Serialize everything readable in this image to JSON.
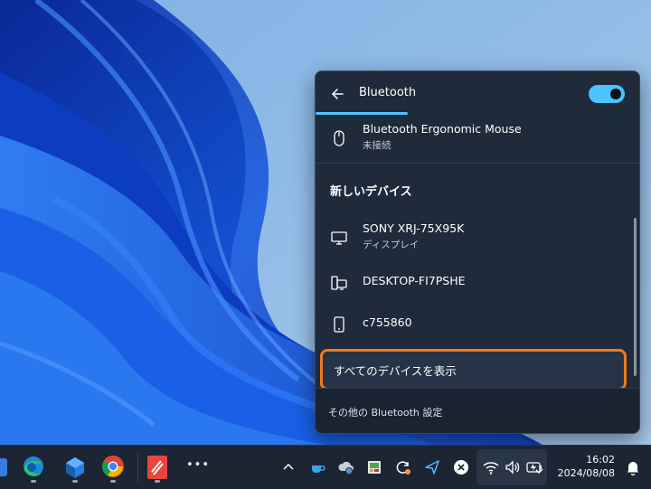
{
  "flyout": {
    "title": "Bluetooth",
    "toggle_on": true,
    "paired_device": {
      "name": "Bluetooth Ergonomic Mouse",
      "status": "未接続",
      "icon": "mouse-icon"
    },
    "new_devices_heading": "新しいデバイス",
    "new_devices": [
      {
        "name": "SONY XRJ-75X95K",
        "status": "ディスプレイ",
        "icon": "monitor-icon"
      },
      {
        "name": "DESKTOP-FI7PSHE",
        "status": "",
        "icon": "desktop-computer-icon"
      },
      {
        "name": "c755860",
        "status": "",
        "icon": "phone-icon"
      }
    ],
    "show_all_label": "すべてのデバイスを表示",
    "footer_link": "その他の Bluetooth 設定"
  },
  "taskbar": {
    "apps": [
      "edge-icon",
      "app-cube-icon",
      "chrome-icon",
      "pdf-app-icon"
    ],
    "more_label": "•••",
    "tray_icons": [
      "chevron-up-icon",
      "cup-icon",
      "cloud-sync-icon",
      "app-tile-icon",
      "refresh-icon",
      "send-icon",
      "close-circle-icon"
    ],
    "time": "16:02",
    "date": "2024/08/08"
  },
  "colors": {
    "accent": "#4cc2ff",
    "highlight": "#f07a1a"
  }
}
